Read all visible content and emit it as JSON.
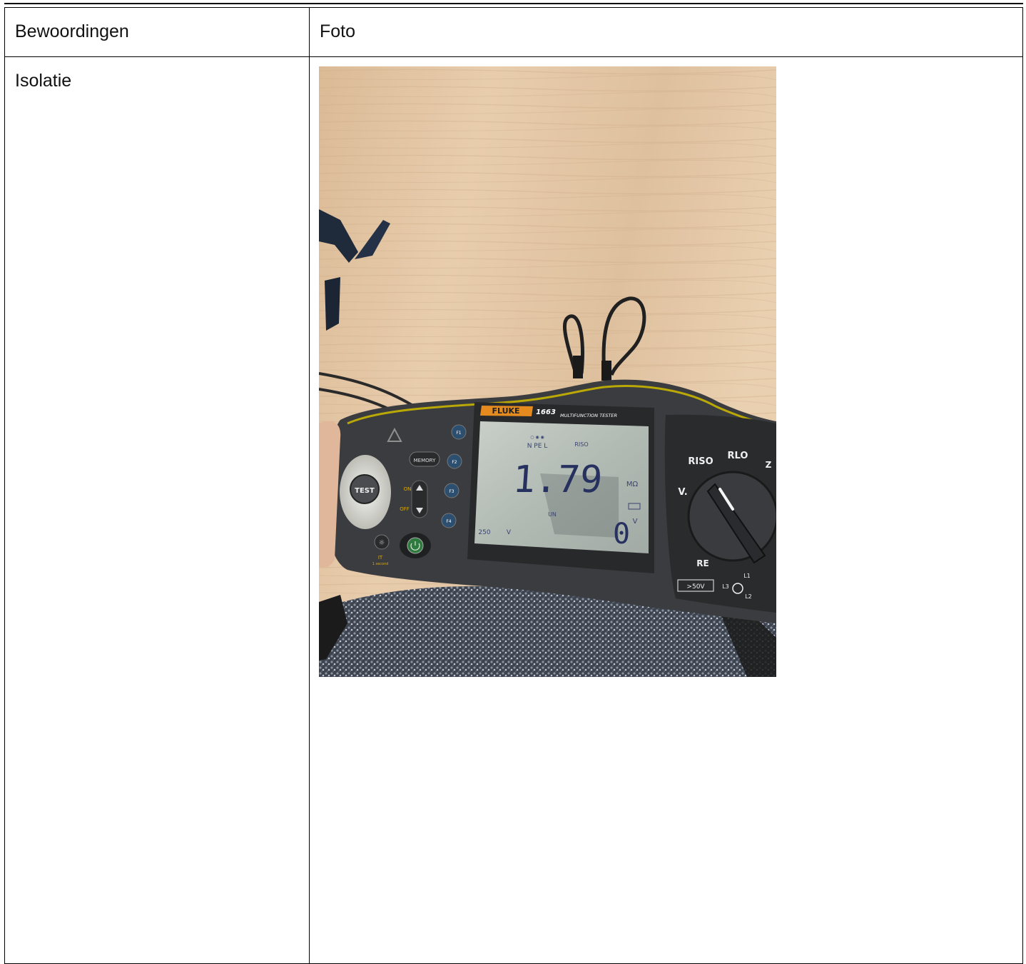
{
  "table": {
    "header": {
      "col1": "Bewoordingen",
      "col2": "Foto"
    },
    "rows": [
      {
        "label": "Isolatie",
        "photo": {
          "brand": "FLUKE",
          "model": "1663",
          "model_caption": "MULTIFUNCTION TESTER",
          "reading_main": "1.79",
          "reading_main_unit": "MΩ",
          "reading_main_label": "RISO",
          "reading_sub": "0",
          "reading_sub_unit": "V",
          "reading_sub_label": "UN",
          "test_voltage": "250",
          "test_voltage_unit": "V",
          "conductors": "N PE L",
          "buttons": {
            "test": "TEST",
            "memory": "MEMORY",
            "on": "ON",
            "off": "OFF",
            "f1": "F1",
            "f2": "F2",
            "f3": "F3",
            "f4": "F4",
            "it": "IT",
            "it_sub": "1 second"
          },
          "dial": {
            "riso": "RISO",
            "rlo": "RLO",
            "v": "V.",
            "re": "RE",
            "z": "Z",
            "l1": "L1",
            "l2": "L2",
            "l3": "L3",
            "warning": ">50V"
          }
        }
      }
    ]
  }
}
